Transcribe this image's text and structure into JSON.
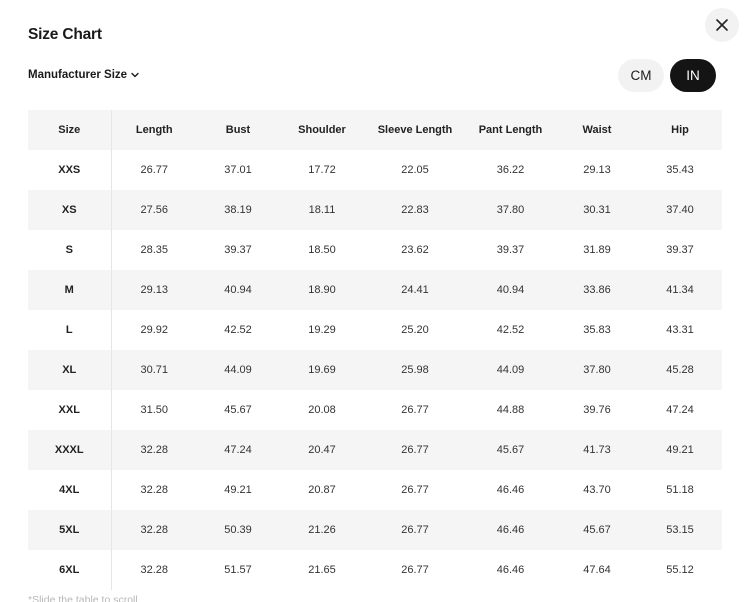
{
  "dialog": {
    "title": "Size Chart",
    "size_system_label": "Manufacturer Size",
    "units": {
      "cm": "CM",
      "in": "IN",
      "selected": "IN"
    },
    "hint": "*Slide the table to scroll"
  },
  "table": {
    "headers": [
      "Size",
      "Length",
      "Bust",
      "Shoulder",
      "Sleeve Length",
      "Pant Length",
      "Waist",
      "Hip"
    ],
    "rows": [
      [
        "XXS",
        "26.77",
        "37.01",
        "17.72",
        "22.05",
        "36.22",
        "29.13",
        "35.43"
      ],
      [
        "XS",
        "27.56",
        "38.19",
        "18.11",
        "22.83",
        "37.80",
        "30.31",
        "37.40"
      ],
      [
        "S",
        "28.35",
        "39.37",
        "18.50",
        "23.62",
        "39.37",
        "31.89",
        "39.37"
      ],
      [
        "M",
        "29.13",
        "40.94",
        "18.90",
        "24.41",
        "40.94",
        "33.86",
        "41.34"
      ],
      [
        "L",
        "29.92",
        "42.52",
        "19.29",
        "25.20",
        "42.52",
        "35.83",
        "43.31"
      ],
      [
        "XL",
        "30.71",
        "44.09",
        "19.69",
        "25.98",
        "44.09",
        "37.80",
        "45.28"
      ],
      [
        "XXL",
        "31.50",
        "45.67",
        "20.08",
        "26.77",
        "44.88",
        "39.76",
        "47.24"
      ],
      [
        "XXXL",
        "32.28",
        "47.24",
        "20.47",
        "26.77",
        "45.67",
        "41.73",
        "49.21"
      ],
      [
        "4XL",
        "32.28",
        "49.21",
        "20.87",
        "26.77",
        "46.46",
        "43.70",
        "51.18"
      ],
      [
        "5XL",
        "32.28",
        "50.39",
        "21.26",
        "26.77",
        "46.46",
        "45.67",
        "53.15"
      ],
      [
        "6XL",
        "32.28",
        "51.57",
        "21.65",
        "26.77",
        "46.46",
        "47.64",
        "55.12"
      ]
    ]
  },
  "icons": {
    "close": "close-icon",
    "dropdown": "chevron-down-icon"
  },
  "colors": {
    "selected_toggle_bg": "#141414",
    "unselected_toggle_bg": "#f2f2f2",
    "stripe_bg": "#f5f5f5"
  }
}
